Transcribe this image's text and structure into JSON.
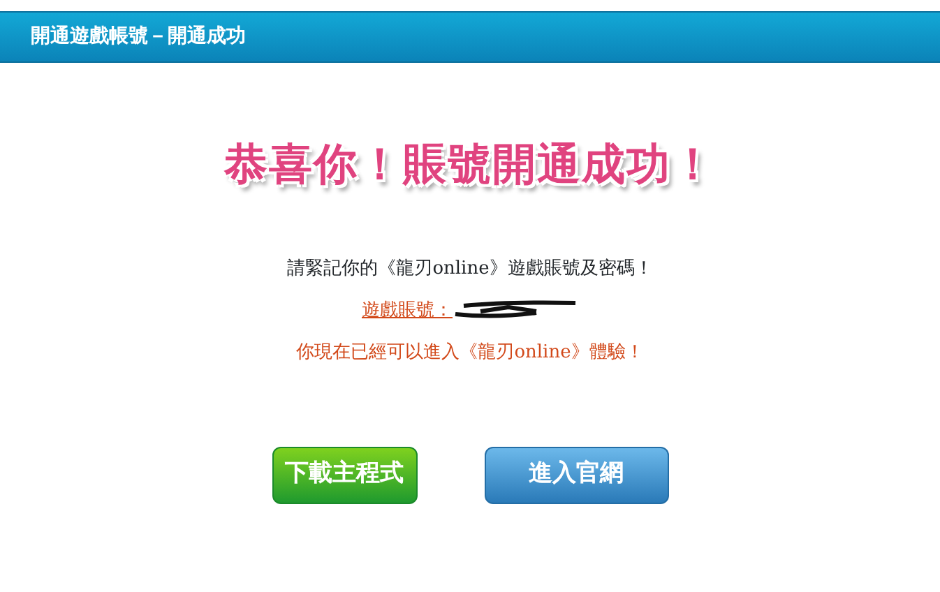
{
  "header": {
    "title": "開通遊戲帳號－開通成功"
  },
  "headline": "恭喜你！賬號開通成功！",
  "notice": "請緊記你的《龍刃online》遊戲賬號及密碼！",
  "account": {
    "label": "遊戲賬號：",
    "redacted": true
  },
  "message": "你現在已經可以進入《龍刃online》體驗！",
  "buttons": [
    {
      "label": "下載主程式",
      "kind": "green"
    },
    {
      "label": "進入官網",
      "kind": "blue"
    }
  ]
}
